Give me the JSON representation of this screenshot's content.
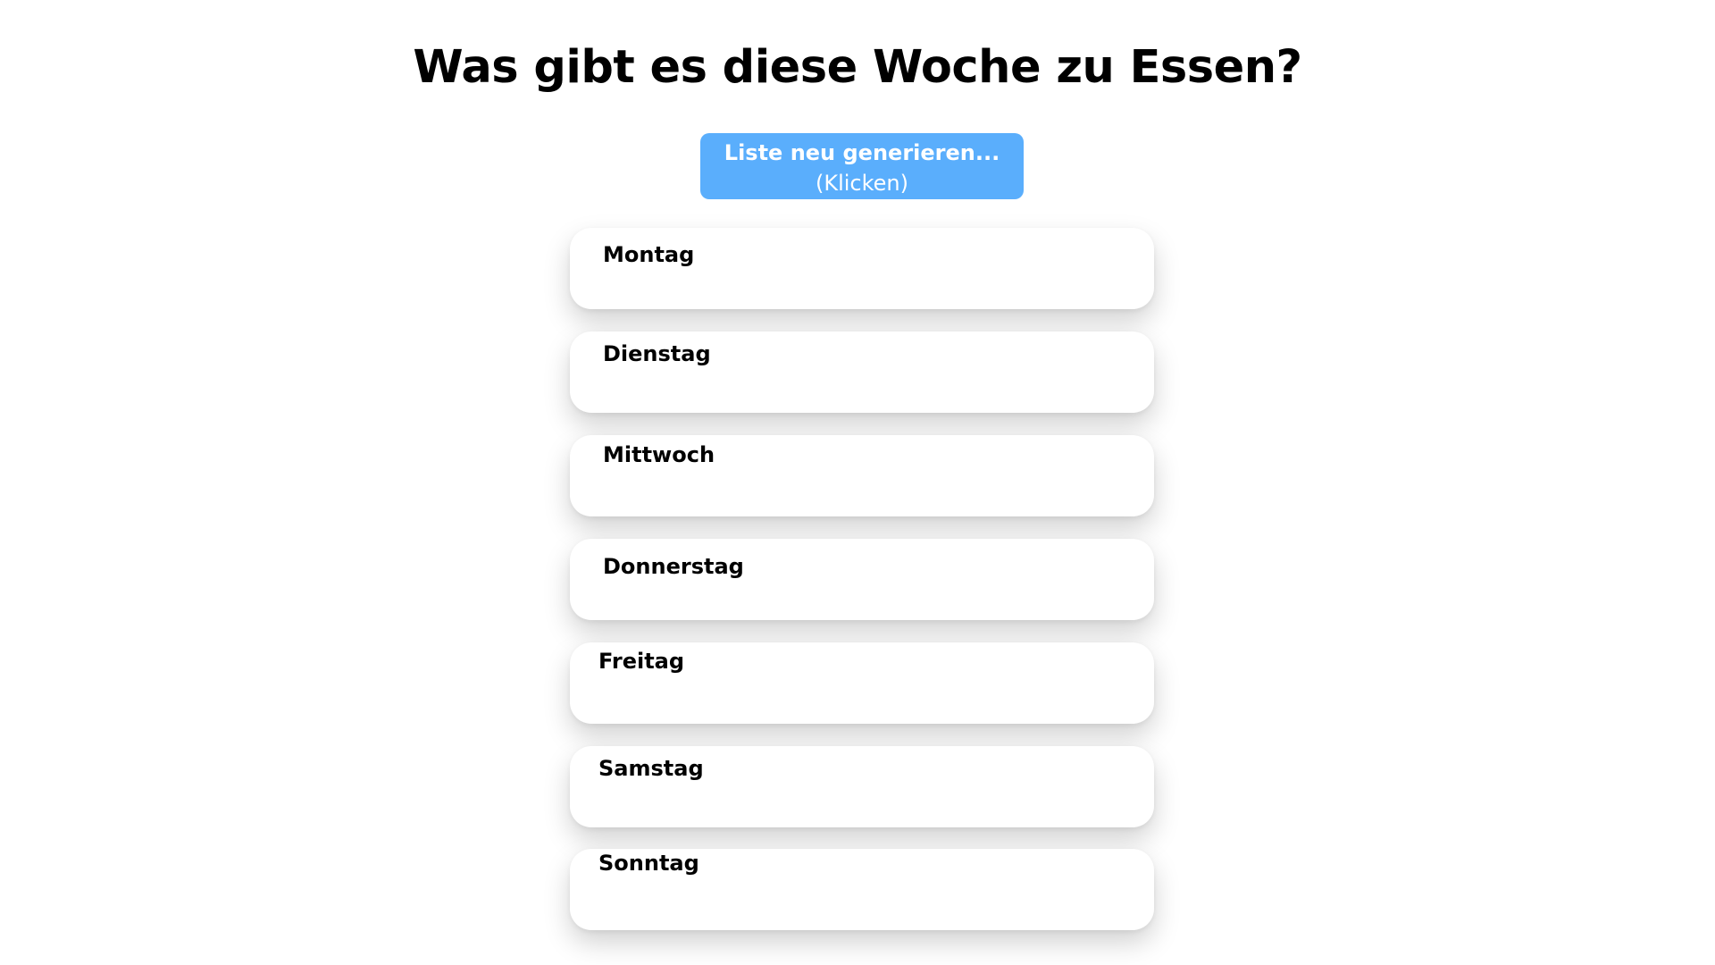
{
  "page": {
    "title": "Was gibt es diese Woche zu Essen?"
  },
  "regenerate_button": {
    "label": "Liste neu generieren...",
    "hint": "(Klicken)",
    "color": "#5aaefc"
  },
  "days": [
    {
      "label": "Montag"
    },
    {
      "label": "Dienstag"
    },
    {
      "label": "Mittwoch"
    },
    {
      "label": "Donnerstag"
    },
    {
      "label": "Freitag"
    },
    {
      "label": "Samstag"
    },
    {
      "label": "Sonntag"
    }
  ]
}
